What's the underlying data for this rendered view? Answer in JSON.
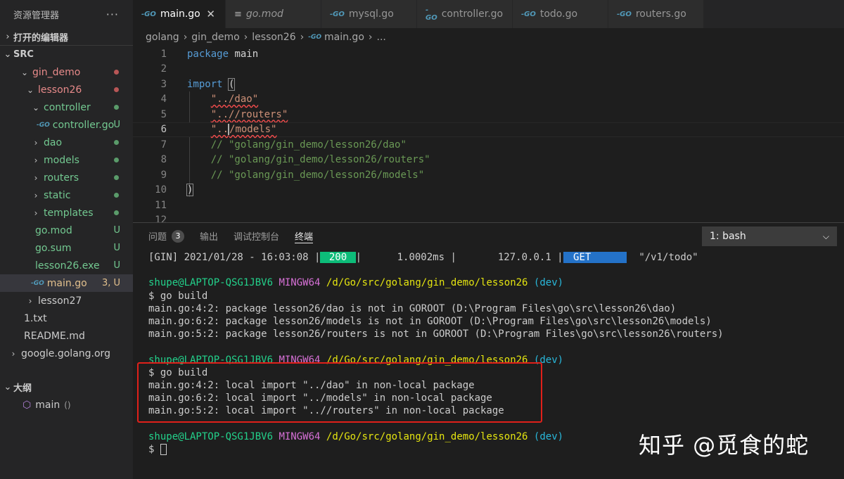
{
  "sidebar": {
    "title": "资源管理器",
    "more": "···",
    "open_editors": "打开的编辑器",
    "root": "SRC",
    "tree": [
      {
        "name": "gin_demo",
        "color": "red",
        "indent": 1,
        "chev": "down",
        "status": "dot-red"
      },
      {
        "name": "lesson26",
        "color": "red",
        "indent": 2,
        "chev": "down",
        "status": "dot-red"
      },
      {
        "name": "controller",
        "color": "green",
        "indent": 3,
        "chev": "down",
        "status": "dot-green"
      },
      {
        "name": "controller.go",
        "color": "green",
        "indent": 4,
        "chev": "",
        "go": true,
        "status": "U"
      },
      {
        "name": "dao",
        "color": "green",
        "indent": 3,
        "chev": "right",
        "status": "dot-green"
      },
      {
        "name": "models",
        "color": "green",
        "indent": 3,
        "chev": "right",
        "status": "dot-green"
      },
      {
        "name": "routers",
        "color": "green",
        "indent": 3,
        "chev": "right",
        "status": "dot-green"
      },
      {
        "name": "static",
        "color": "green",
        "indent": 3,
        "chev": "right",
        "status": "dot-green"
      },
      {
        "name": "templates",
        "color": "green",
        "indent": 3,
        "chev": "right",
        "status": "dot-green"
      },
      {
        "name": "go.mod",
        "color": "green",
        "indent": 3,
        "chev": "",
        "file": true,
        "status": "U"
      },
      {
        "name": "go.sum",
        "color": "green",
        "indent": 3,
        "chev": "",
        "file": true,
        "status": "U"
      },
      {
        "name": "lesson26.exe",
        "color": "green",
        "indent": 3,
        "chev": "",
        "file": true,
        "status": "U"
      },
      {
        "name": "main.go",
        "color": "yellow",
        "indent": 3,
        "chev": "",
        "go": true,
        "status": "3, U",
        "selected": true
      },
      {
        "name": "lesson27",
        "color": "default",
        "indent": 2,
        "chev": "right",
        "status": ""
      },
      {
        "name": "1.txt",
        "color": "default",
        "indent": 1,
        "chev": "",
        "file": true,
        "status": ""
      },
      {
        "name": "README.md",
        "color": "default",
        "indent": 1,
        "chev": "",
        "file": true,
        "status": ""
      },
      {
        "name": "google.golang.org",
        "color": "default",
        "indent": 0,
        "chev": "right",
        "status": ""
      }
    ],
    "outline": "大纲",
    "outline_item": "main",
    "outline_item_detail": "()"
  },
  "tabs": [
    {
      "label": "main.go",
      "icon": "go",
      "active": true,
      "italic": false
    },
    {
      "label": "go.mod",
      "icon": "mod",
      "active": false,
      "italic": true
    },
    {
      "label": "mysql.go",
      "icon": "go",
      "active": false,
      "italic": false
    },
    {
      "label": "controller.go",
      "icon": "go",
      "active": false,
      "italic": false
    },
    {
      "label": "todo.go",
      "icon": "go",
      "active": false,
      "italic": false
    },
    {
      "label": "routers.go",
      "icon": "go",
      "active": false,
      "italic": false
    }
  ],
  "tab_close": "✕",
  "breadcrumb": [
    "golang",
    "gin_demo",
    "lesson26",
    "main.go",
    "..."
  ],
  "editor": {
    "lines": [
      "1",
      "2",
      "3",
      "4",
      "5",
      "6",
      "7",
      "8",
      "9",
      "10",
      "11",
      "12"
    ],
    "kw_package": "package",
    "pkg_name": "main",
    "kw_import": "import",
    "paren_open": "(",
    "paren_close": ")",
    "imp_dao": "\"../dao\"",
    "imp_routers": "\"..//routers\"",
    "imp_models_a": "\"..",
    "imp_models_b": "/models\"",
    "cmt_dao": "// \"golang/gin_demo/lesson26/dao\"",
    "cmt_routers": "// \"golang/gin_demo/lesson26/routers\"",
    "cmt_models": "// \"golang/gin_demo/lesson26/models\""
  },
  "panel": {
    "tabs": [
      "问题",
      "输出",
      "调试控制台",
      "终端"
    ],
    "problem_count": "3",
    "terminal_select": "1: bash"
  },
  "terminal": {
    "gin_prefix": "[GIN] 2021/01/28 - 16:03:08 |",
    "gin_status": " 200 ",
    "gin_mid": "|      1.0002ms |       127.0.0.1 |",
    "gin_method": " GET     ",
    "gin_path": "  \"/v1/todo\"",
    "user": "shupe@LAPTOP-QSG1JBV6",
    "env": "MINGW64",
    "path": "/d/Go/src/golang/gin_demo/lesson26",
    "branch": "(dev)",
    "cmd_build": "$ go build",
    "err1": [
      "main.go:4:2: package lesson26/dao is not in GOROOT (D:\\Program Files\\go\\src\\lesson26\\dao)",
      "main.go:6:2: package lesson26/models is not in GOROOT (D:\\Program Files\\go\\src\\lesson26\\models)",
      "main.go:5:2: package lesson26/routers is not in GOROOT (D:\\Program Files\\go\\src\\lesson26\\routers)"
    ],
    "err2": [
      "main.go:4:2: local import \"../dao\" in non-local package",
      "main.go:6:2: local import \"../models\" in non-local package",
      "main.go:5:2: local import \"..//routers\" in non-local package"
    ],
    "prompt": "$ "
  },
  "watermark": "知乎 @觅食的蛇"
}
